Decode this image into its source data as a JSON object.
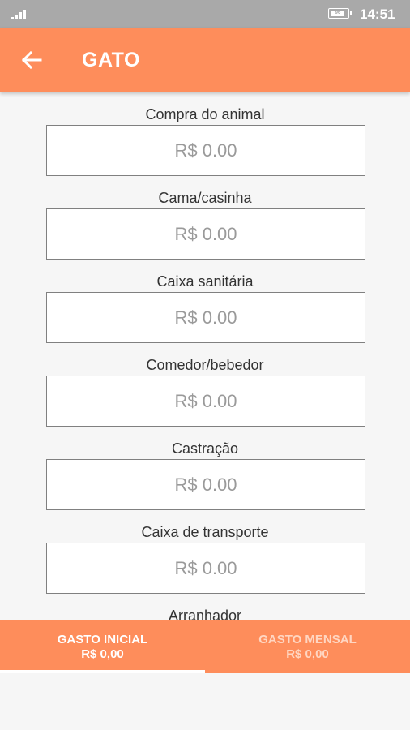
{
  "status_bar": {
    "battery": "96",
    "time": "14:51",
    "icons": [
      "signal-icon",
      "battery-icon"
    ]
  },
  "app_bar": {
    "back_icon": "arrow-left-icon",
    "title": "GATO"
  },
  "fields": [
    {
      "label": "Compra do animal",
      "value": "R$ 0.00"
    },
    {
      "label": "Cama/casinha",
      "value": "R$ 0.00"
    },
    {
      "label": "Caixa sanitária",
      "value": "R$ 0.00"
    },
    {
      "label": "Comedor/bebedor",
      "value": "R$ 0.00"
    },
    {
      "label": "Castração",
      "value": "R$ 0.00"
    },
    {
      "label": "Caixa de transporte",
      "value": "R$ 0.00"
    },
    {
      "label": "Arranhador",
      "value": ""
    }
  ],
  "tabs": [
    {
      "label": "GASTO INICIAL",
      "value": "R$ 0,00",
      "active": true
    },
    {
      "label": "GASTO MENSAL",
      "value": "R$ 0,00",
      "active": false
    }
  ],
  "colors": {
    "accent": "#fe8d5b",
    "status_bar": "#a9a9a9",
    "background": "#f6f6f6"
  }
}
